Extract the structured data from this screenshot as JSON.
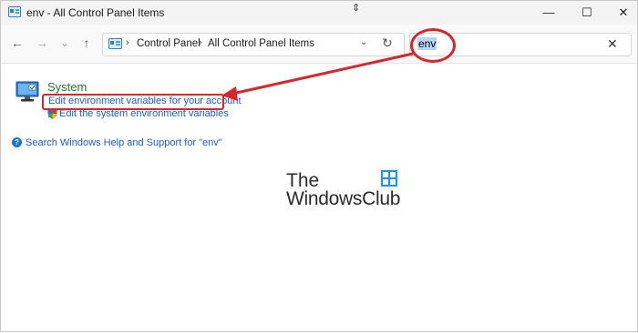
{
  "window": {
    "title": "env - All Control Panel Items",
    "minimize_glyph": "—",
    "maximize_glyph": "☐",
    "close_glyph": "✕"
  },
  "toolbar": {
    "back_glyph": "←",
    "forward_glyph": "→",
    "recent_glyph": "⌄",
    "up_glyph": "↑",
    "breadcrumb": [
      "Control Panel",
      "All Control Panel Items"
    ],
    "separator_glyph": "›",
    "dropdown_glyph": "⌄",
    "refresh_glyph": "↻"
  },
  "search": {
    "value": "env",
    "clear_glyph": "✕"
  },
  "results": {
    "section_title": "System",
    "links": [
      "Edit environment variables for your account",
      "Edit the system environment variables"
    ],
    "help_link": "Search Windows Help and Support for \"env\"",
    "help_glyph": "?"
  },
  "watermark": {
    "line1": "The",
    "line2": "WindowsClub"
  },
  "annotation": {
    "color": "#d7262e"
  },
  "icons": [
    "control-panel-icon",
    "computer-icon",
    "uac-shield-icon",
    "help-icon",
    "watermark-logo-icon"
  ]
}
